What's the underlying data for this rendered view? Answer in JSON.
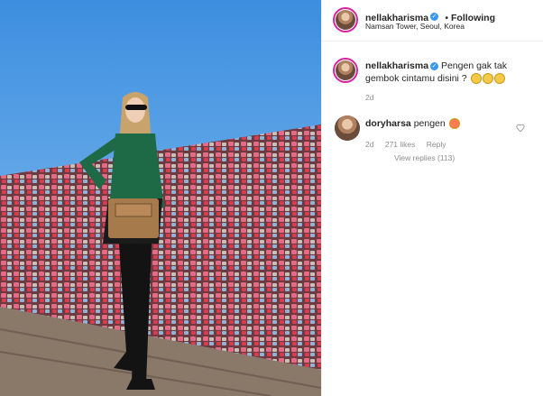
{
  "post": {
    "author": "nellakharisma",
    "following_label": "Following",
    "location": "Namsan Tower, Seoul, Korea"
  },
  "caption": {
    "username": "nellakharisma",
    "text": "Pengen gak tak gembok cintamu disini ?",
    "time": "2d"
  },
  "comment": {
    "username": "doryharsa",
    "text": "pengen",
    "time": "2d",
    "likes": "271 likes",
    "reply_label": "Reply",
    "view_replies": "View replies (113)"
  },
  "icons": [
    "verified-badge-icon",
    "heart-icon",
    "laughing-emoji-icon",
    "heart-eyes-emoji-icon"
  ],
  "colors": {
    "accent": "#3897f0",
    "story_ring": "#d6249f",
    "muted": "#8e8e8e"
  }
}
